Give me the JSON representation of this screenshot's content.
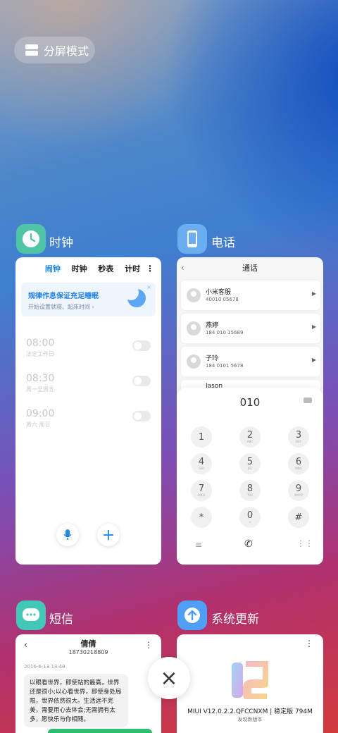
{
  "split_screen": {
    "label": "分屏模式"
  },
  "apps": {
    "clock": {
      "name": "时钟",
      "tabs": [
        "闹钟",
        "时钟",
        "秒表",
        "计时"
      ],
      "more": "⋮",
      "banner": {
        "title": "规律作息保证充足睡眠",
        "subtitle": "开始设置就寝、起床时间 ›",
        "close": "×"
      },
      "alarms": [
        {
          "time": "08:00",
          "label": "法定工作日"
        },
        {
          "time": "08:30",
          "label": "周一至周五"
        },
        {
          "time": "09:00",
          "label": "周六 周日"
        }
      ],
      "add": "+"
    },
    "phone": {
      "name": "电话",
      "header": "通话",
      "back": "‹",
      "contacts": [
        {
          "name": "小米客服",
          "number": "40010 05678"
        },
        {
          "name": "燕婷",
          "number": "184 010 15689"
        },
        {
          "name": "子玲",
          "number": "184 0101 5678"
        },
        {
          "name": "Jason",
          "number": ""
        }
      ],
      "dialed": "010",
      "keys": [
        {
          "d": "1",
          "l": ""
        },
        {
          "d": "2",
          "l": "ABC"
        },
        {
          "d": "3",
          "l": "DEF"
        },
        {
          "d": "4",
          "l": "GHI"
        },
        {
          "d": "5",
          "l": "JKL"
        },
        {
          "d": "6",
          "l": "MNO"
        },
        {
          "d": "7",
          "l": "PQRS"
        },
        {
          "d": "8",
          "l": "TUV"
        },
        {
          "d": "9",
          "l": "WXYZ"
        },
        {
          "d": "*",
          "l": ""
        },
        {
          "d": "0",
          "l": "+"
        },
        {
          "d": "#",
          "l": ""
        }
      ]
    },
    "sms": {
      "name": "短信",
      "contact_name": "倩倩",
      "contact_number": "18730218809",
      "date": "2016-6-13 13:49",
      "message": "以眼看世界，即使站的最高，世界还是很小;以心看世界，即使身处局限，世界依然很大。生活远不完美，需要用心去体会;无需拥有太多，愿快乐与你相随。"
    },
    "update": {
      "name": "系统更新",
      "version": "MIUI V12.0.2.2.QFCCNXM | 稳定版 794M",
      "status": "发现新版本"
    }
  },
  "close_all": "×",
  "colors": {
    "accent": "#1b8bf0",
    "clock_icon": "#4fc5a6",
    "phone_icon": "#6aaef0",
    "sms_icon": "#43c7b6",
    "update_icon": "#4e9ff5"
  }
}
